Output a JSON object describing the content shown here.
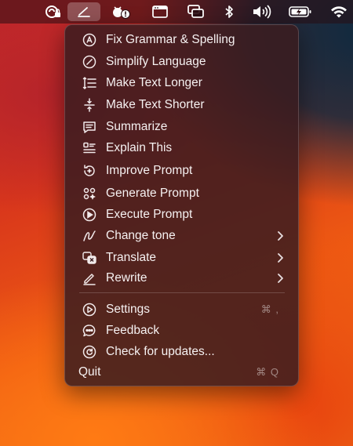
{
  "menubar": {
    "icons": [
      "ai-assistant-lock-icon",
      "writing-assistant-icon",
      "bug-alert-icon",
      "window-icon",
      "screen-mirroring-icon",
      "bluetooth-icon",
      "volume-icon",
      "battery-charging-icon",
      "wifi-icon"
    ]
  },
  "menu": {
    "items": [
      {
        "label": "Fix Grammar & Spelling",
        "icon": "grammar-icon"
      },
      {
        "label": "Simplify Language",
        "icon": "simplify-icon"
      },
      {
        "label": "Make Text Longer",
        "icon": "expand-text-icon"
      },
      {
        "label": "Make Text Shorter",
        "icon": "shorten-text-icon"
      },
      {
        "label": "Summarize",
        "icon": "summarize-icon"
      },
      {
        "label": "Explain This",
        "icon": "explain-icon"
      },
      {
        "label": "Improve Prompt",
        "icon": "improve-prompt-icon"
      },
      {
        "label": "Generate Prompt",
        "icon": "generate-prompt-icon"
      },
      {
        "label": "Execute Prompt",
        "icon": "play-icon"
      },
      {
        "label": "Change tone",
        "icon": "tone-icon",
        "submenu": true
      },
      {
        "label": "Translate",
        "icon": "translate-icon",
        "submenu": true
      },
      {
        "label": "Rewrite",
        "icon": "pencil-icon",
        "submenu": true
      }
    ],
    "settings": {
      "label": "Settings",
      "shortcut": "⌘ ,",
      "icon": "settings-icon"
    },
    "feedback": {
      "label": "Feedback",
      "icon": "feedback-icon"
    },
    "updates": {
      "label": "Check for updates...",
      "icon": "update-icon"
    },
    "quit": {
      "label": "Quit",
      "shortcut": "⌘ Q"
    }
  },
  "colors": {
    "menu_bg": "#3a1c20",
    "text": "#f6f1f1",
    "shortcut_text": "#9a8a8c"
  }
}
